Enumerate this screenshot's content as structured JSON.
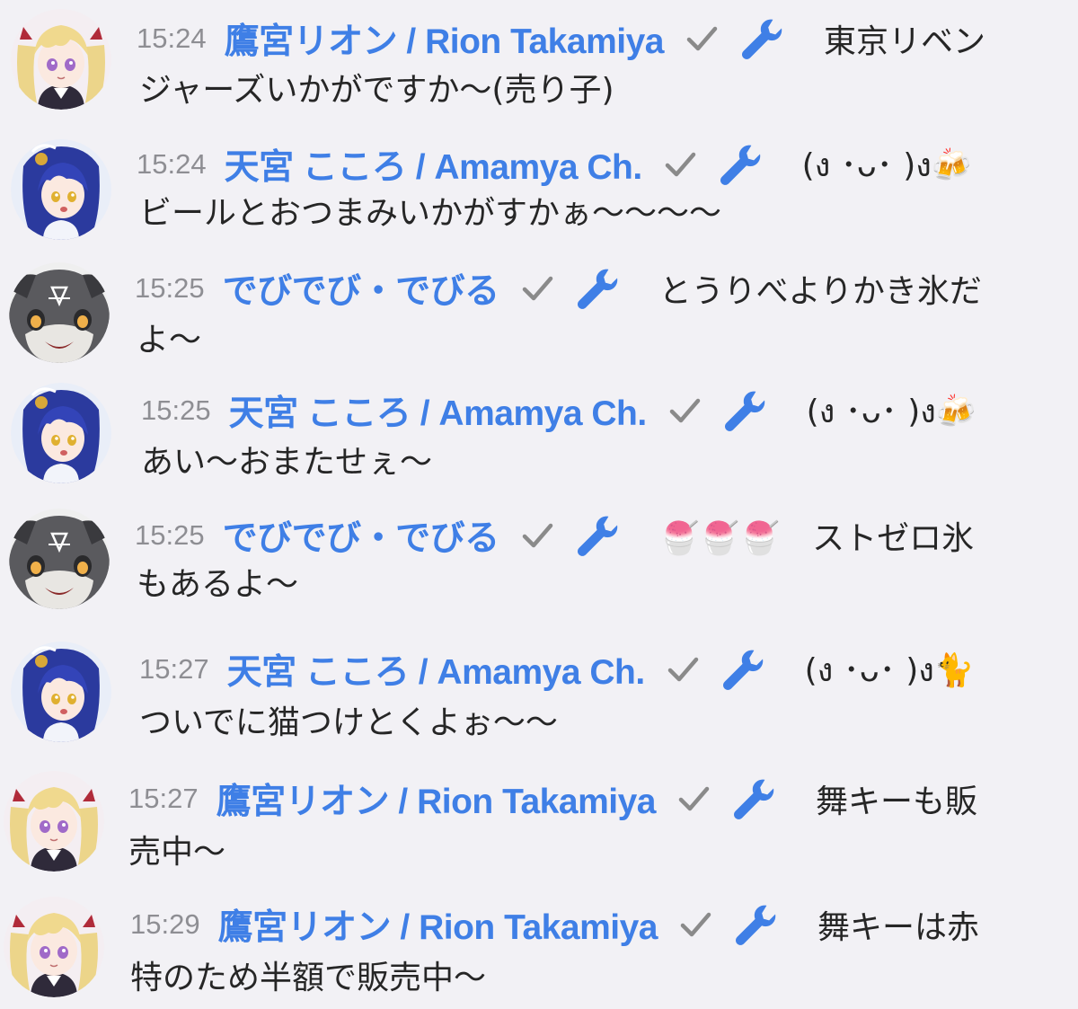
{
  "messages": [
    {
      "time": "15:24",
      "author": "鷹宮リオン / Rion Takamiya",
      "text1": "東京リベン",
      "text2": "ジャーズいかがですか〜(売り子)",
      "avatar": "rion"
    },
    {
      "time": "15:24",
      "author": "天宮 こころ / Amamya Ch.",
      "text1": "(ง ･ᴗ･ )ง🍻",
      "text2": "ビールとおつまみいかがすかぁ〜〜〜〜",
      "avatar": "kokoro"
    },
    {
      "time": "15:25",
      "author": "でびでび・でびる",
      "text1": "とうりべよりかき氷だ",
      "text2": "よ〜",
      "avatar": "debi"
    },
    {
      "time": "15:25",
      "author": "天宮 こころ / Amamya Ch.",
      "text1": "(ง ･ᴗ･ )ง🍻",
      "text2": "あい〜おまたせぇ〜",
      "avatar": "kokoro"
    },
    {
      "time": "15:25",
      "author": "でびでび・でびる",
      "text1": "🍧🍧🍧　ストゼロ氷",
      "text2": "もあるよ〜",
      "avatar": "debi"
    },
    {
      "time": "15:27",
      "author": "天宮 こころ / Amamya Ch.",
      "text1": "(ง ･ᴗ･ )ง🐈",
      "text2": "ついでに猫つけとくよぉ〜〜",
      "avatar": "kokoro"
    },
    {
      "time": "15:27",
      "author": "鷹宮リオン / Rion Takamiya",
      "text1": "舞キーも販",
      "text2": "売中〜",
      "avatar": "rion"
    },
    {
      "time": "15:29",
      "author": "鷹宮リオン / Rion Takamiya",
      "text1": "舞キーは赤",
      "text2": "特のため半額で販売中〜",
      "avatar": "rion"
    }
  ],
  "icons": {
    "verified": "check-icon",
    "moderator": "wrench-icon"
  },
  "colors": {
    "background": "#f2f1f5",
    "author": "#3f7fe6",
    "time": "#8e8e93",
    "check": "#8a8a8a",
    "wrench": "#3f7fe6",
    "text": "#262626"
  }
}
